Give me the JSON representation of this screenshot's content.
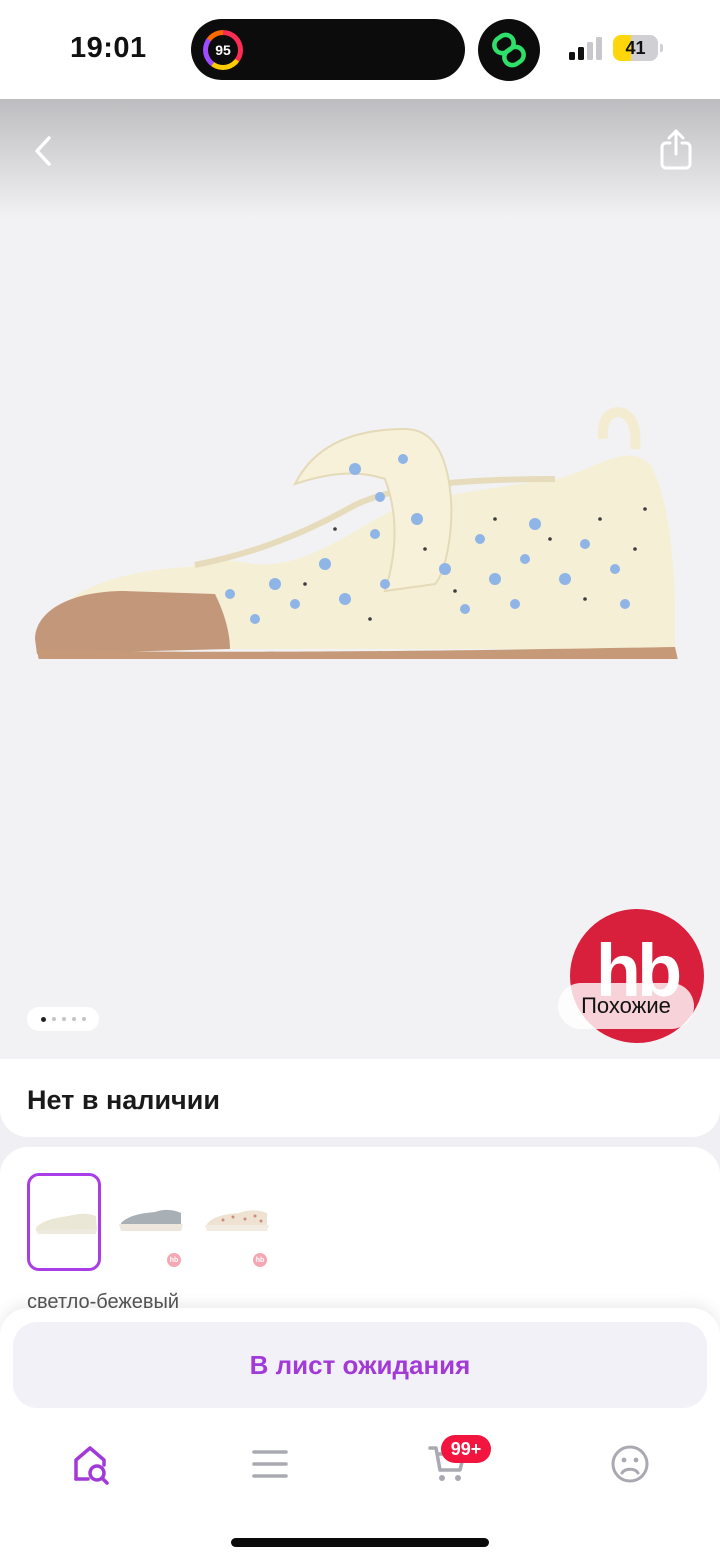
{
  "status_bar": {
    "time": "19:01",
    "activity_value": "95",
    "battery_level": "41",
    "battery_percent": 41
  },
  "gallery": {
    "image_count": 5,
    "current_image": 1,
    "brand_logo_text": "hb",
    "similar_label": "Похожие"
  },
  "product": {
    "availability": "Нет в наличии",
    "selected_color": "светло-бежевый",
    "variants": [
      {
        "name": "variant-light-beige",
        "selected": true
      },
      {
        "name": "variant-grey",
        "selected": false
      },
      {
        "name": "variant-beige-dots",
        "selected": false
      }
    ],
    "variant_badge_text": "hb"
  },
  "actions": {
    "waitlist_label": "В лист ожидания"
  },
  "tab_bar": {
    "tabs": [
      "home-search-icon",
      "menu-icon",
      "cart-icon",
      "profile-icon"
    ],
    "cart_badge": "99+"
  },
  "colors": {
    "accent": "#a23ad8",
    "badge": "#f2153f",
    "brand": "#d81f3c"
  }
}
